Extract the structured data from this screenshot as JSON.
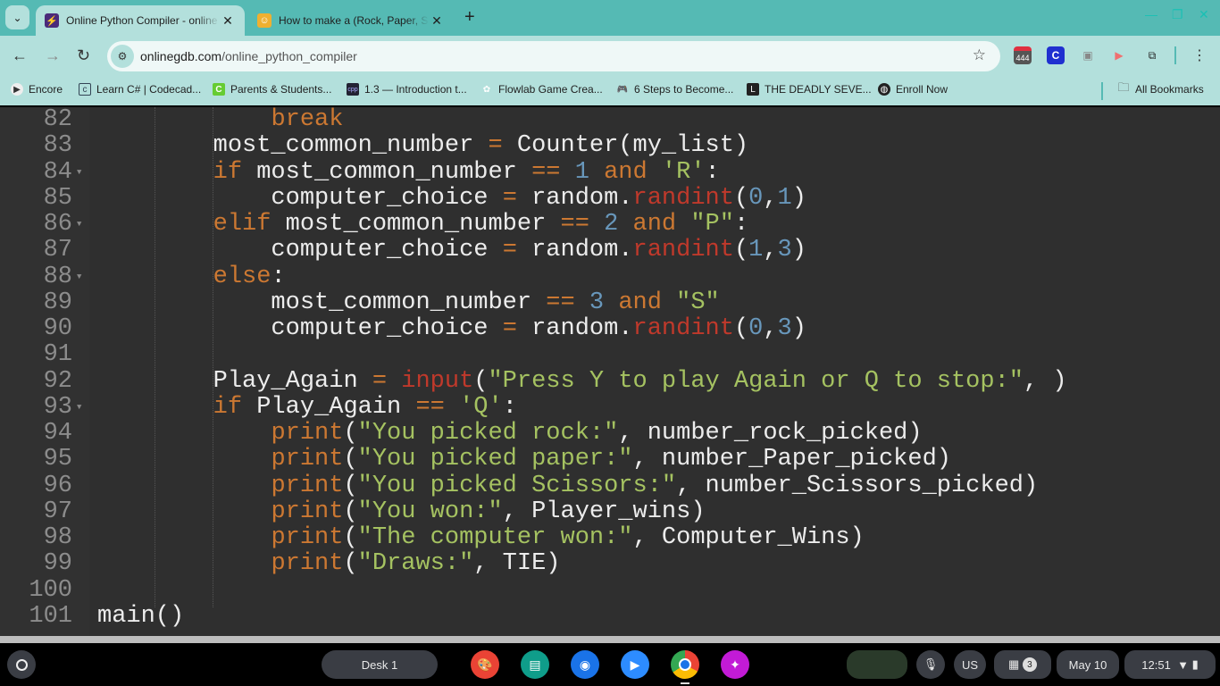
{
  "browser": {
    "tabs": [
      {
        "title": "Online Python Compiler - online editor",
        "icon": "lightning-icon",
        "active": true
      },
      {
        "title": "How to make a (Rock, Paper, Scissors)",
        "icon": "avatar-icon",
        "active": false
      }
    ],
    "url_domain": "onlinegdb.com",
    "url_path": "/online_python_compiler",
    "extension_badge": "444",
    "extension_c": "C",
    "bookmarks": [
      "Encore",
      "Learn C# | Codecad...",
      "Parents & Students...",
      "1.3 — Introduction t...",
      "Flowlab Game Crea...",
      "6 Steps to Become...",
      "THE DEADLY SEVE...",
      "Enroll Now"
    ],
    "all_bookmarks": "All Bookmarks",
    "accent": "#55bab4"
  },
  "editor": {
    "colors": {
      "keyword": "#cc7832",
      "builtin": "#c0392b",
      "number": "#6897bb",
      "string": "#a5c261",
      "text": "#ececec",
      "background": "#2f2f2f"
    },
    "lines": [
      {
        "n": "82",
        "fold": false,
        "tokens": [
          [
            "t",
            "            "
          ],
          [
            "k",
            "break"
          ]
        ]
      },
      {
        "n": "83",
        "fold": false,
        "tokens": [
          [
            "t",
            "        most_common_number "
          ],
          [
            "k",
            "="
          ],
          [
            "t",
            " Counter(my_list)"
          ]
        ]
      },
      {
        "n": "84",
        "fold": true,
        "tokens": [
          [
            "t",
            "        "
          ],
          [
            "k",
            "if"
          ],
          [
            "t",
            " most_common_number "
          ],
          [
            "k",
            "=="
          ],
          [
            "t",
            " "
          ],
          [
            "n",
            "1"
          ],
          [
            "t",
            " "
          ],
          [
            "k",
            "and"
          ],
          [
            "t",
            " "
          ],
          [
            "s",
            "'R'"
          ],
          [
            "t",
            ":"
          ]
        ]
      },
      {
        "n": "85",
        "fold": false,
        "tokens": [
          [
            "t",
            "            computer_choice "
          ],
          [
            "k",
            "="
          ],
          [
            "t",
            " random."
          ],
          [
            "f",
            "randint"
          ],
          [
            "t",
            "("
          ],
          [
            "n",
            "0"
          ],
          [
            "t",
            ","
          ],
          [
            "n",
            "1"
          ],
          [
            "t",
            ")"
          ]
        ]
      },
      {
        "n": "86",
        "fold": true,
        "tokens": [
          [
            "t",
            "        "
          ],
          [
            "k",
            "elif"
          ],
          [
            "t",
            " most_common_number "
          ],
          [
            "k",
            "=="
          ],
          [
            "t",
            " "
          ],
          [
            "n",
            "2"
          ],
          [
            "t",
            " "
          ],
          [
            "k",
            "and"
          ],
          [
            "t",
            " "
          ],
          [
            "s",
            "\"P\""
          ],
          [
            "t",
            ":"
          ]
        ]
      },
      {
        "n": "87",
        "fold": false,
        "tokens": [
          [
            "t",
            "            computer_choice "
          ],
          [
            "k",
            "="
          ],
          [
            "t",
            " random."
          ],
          [
            "f",
            "randint"
          ],
          [
            "t",
            "("
          ],
          [
            "n",
            "1"
          ],
          [
            "t",
            ","
          ],
          [
            "n",
            "3"
          ],
          [
            "t",
            ")"
          ]
        ]
      },
      {
        "n": "88",
        "fold": true,
        "tokens": [
          [
            "t",
            "        "
          ],
          [
            "k",
            "else"
          ],
          [
            "t",
            ":"
          ]
        ]
      },
      {
        "n": "89",
        "fold": false,
        "tokens": [
          [
            "t",
            "            most_common_number "
          ],
          [
            "k",
            "=="
          ],
          [
            "t",
            " "
          ],
          [
            "n",
            "3"
          ],
          [
            "t",
            " "
          ],
          [
            "k",
            "and"
          ],
          [
            "t",
            " "
          ],
          [
            "s",
            "\"S\""
          ]
        ]
      },
      {
        "n": "90",
        "fold": false,
        "tokens": [
          [
            "t",
            "            computer_choice "
          ],
          [
            "k",
            "="
          ],
          [
            "t",
            " random."
          ],
          [
            "f",
            "randint"
          ],
          [
            "t",
            "("
          ],
          [
            "n",
            "0"
          ],
          [
            "t",
            ","
          ],
          [
            "n",
            "3"
          ],
          [
            "t",
            ")"
          ]
        ]
      },
      {
        "n": "91",
        "fold": false,
        "tokens": []
      },
      {
        "n": "92",
        "fold": false,
        "tokens": [
          [
            "t",
            "        Play_Again "
          ],
          [
            "k",
            "="
          ],
          [
            "t",
            " "
          ],
          [
            "f",
            "input"
          ],
          [
            "t",
            "("
          ],
          [
            "s",
            "\"Press Y to play Again or Q to stop:\""
          ],
          [
            "t",
            ", )"
          ]
        ]
      },
      {
        "n": "93",
        "fold": true,
        "tokens": [
          [
            "t",
            "        "
          ],
          [
            "k",
            "if"
          ],
          [
            "t",
            " Play_Again "
          ],
          [
            "k",
            "=="
          ],
          [
            "t",
            " "
          ],
          [
            "s",
            "'Q'"
          ],
          [
            "t",
            ":"
          ]
        ]
      },
      {
        "n": "94",
        "fold": false,
        "tokens": [
          [
            "t",
            "            "
          ],
          [
            "k",
            "print"
          ],
          [
            "t",
            "("
          ],
          [
            "s",
            "\"You picked rock:\""
          ],
          [
            "t",
            ", number_rock_picked)"
          ]
        ]
      },
      {
        "n": "95",
        "fold": false,
        "tokens": [
          [
            "t",
            "            "
          ],
          [
            "k",
            "print"
          ],
          [
            "t",
            "("
          ],
          [
            "s",
            "\"You picked paper:\""
          ],
          [
            "t",
            ", number_Paper_picked)"
          ]
        ]
      },
      {
        "n": "96",
        "fold": false,
        "tokens": [
          [
            "t",
            "            "
          ],
          [
            "k",
            "print"
          ],
          [
            "t",
            "("
          ],
          [
            "s",
            "\"You picked Scissors:\""
          ],
          [
            "t",
            ", number_Scissors_picked)"
          ]
        ]
      },
      {
        "n": "97",
        "fold": false,
        "tokens": [
          [
            "t",
            "            "
          ],
          [
            "k",
            "print"
          ],
          [
            "t",
            "("
          ],
          [
            "s",
            "\"You won:\""
          ],
          [
            "t",
            ", Player_wins)"
          ]
        ]
      },
      {
        "n": "98",
        "fold": false,
        "tokens": [
          [
            "t",
            "            "
          ],
          [
            "k",
            "print"
          ],
          [
            "t",
            "("
          ],
          [
            "s",
            "\"The computer won:\""
          ],
          [
            "t",
            ", Computer_Wins)"
          ]
        ]
      },
      {
        "n": "99",
        "fold": false,
        "tokens": [
          [
            "t",
            "            "
          ],
          [
            "k",
            "print"
          ],
          [
            "t",
            "("
          ],
          [
            "s",
            "\"Draws:\""
          ],
          [
            "t",
            ", TIE)"
          ]
        ]
      },
      {
        "n": "100",
        "fold": false,
        "tokens": []
      },
      {
        "n": "101",
        "fold": false,
        "tokens": [
          [
            "t",
            "main()"
          ]
        ]
      }
    ]
  },
  "shelf": {
    "desk": "Desk 1",
    "ime": "US",
    "notifications": "3",
    "date": "May 10",
    "time": "12:51"
  }
}
